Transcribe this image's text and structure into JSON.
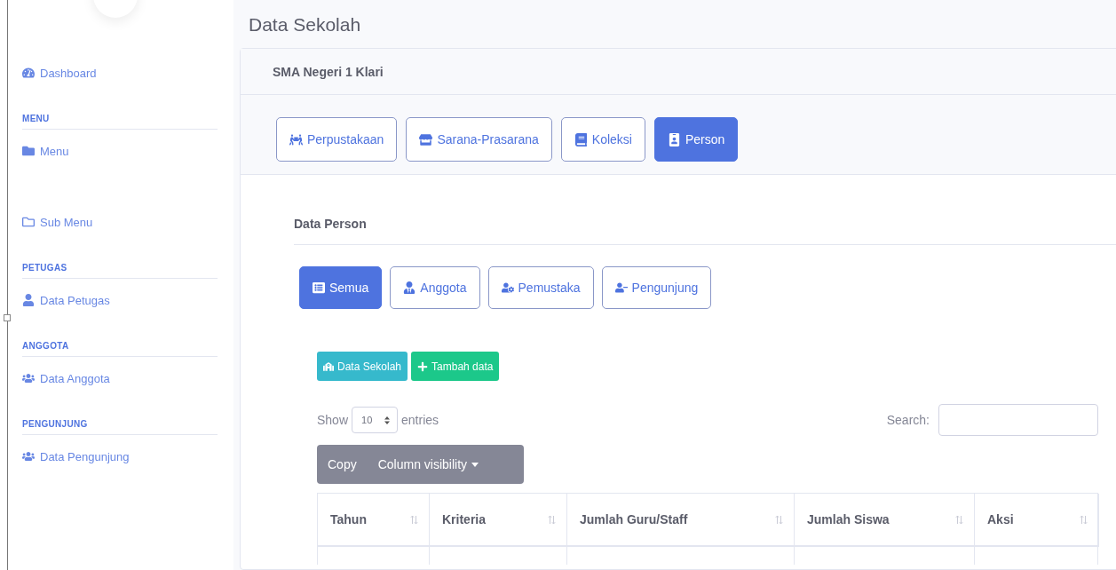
{
  "sidebar": {
    "items": [
      {
        "kind": "link",
        "label": "Dashboard"
      },
      {
        "kind": "heading",
        "label": "MENU"
      },
      {
        "kind": "link",
        "label": "Menu"
      },
      {
        "kind": "link",
        "label": "Sub Menu"
      },
      {
        "kind": "heading",
        "label": "PETUGAS"
      },
      {
        "kind": "link",
        "label": "Data Petugas"
      },
      {
        "kind": "heading",
        "label": "ANGGOTA"
      },
      {
        "kind": "link",
        "label": "Data Anggota"
      },
      {
        "kind": "heading",
        "label": "PENGUNJUNG"
      },
      {
        "kind": "link",
        "label": "Data Pengunjung"
      }
    ]
  },
  "page_title": "Data Sekolah",
  "card": {
    "title": "SMA Negeri 1 Klari",
    "tabs": [
      {
        "label": "Perpustakaan",
        "selected": false
      },
      {
        "label": "Sarana-Prasarana",
        "selected": false
      },
      {
        "label": "Koleksi",
        "selected": false
      },
      {
        "label": "Person",
        "selected": true
      }
    ],
    "section_title": "Data Person",
    "sub_tabs": [
      {
        "label": "Semua",
        "selected": true
      },
      {
        "label": "Anggota",
        "selected": false
      },
      {
        "label": "Pemustaka",
        "selected": false
      },
      {
        "label": "Pengunjung",
        "selected": false
      }
    ],
    "actions": [
      {
        "kind": "info",
        "label": "Data Sekolah"
      },
      {
        "kind": "success",
        "label": "Tambah data"
      }
    ],
    "length": {
      "prefix": "Show",
      "value": "10",
      "suffix": "entries"
    },
    "search": {
      "label": "Search:"
    },
    "export_buttons": [
      {
        "label": "Copy",
        "dropdown": false
      },
      {
        "label": "Column visibility",
        "dropdown": true
      }
    ],
    "table": {
      "columns": [
        "Tahun",
        "Kriteria",
        "Jumlah Guru/Staff",
        "Jumlah Siswa",
        "Aksi"
      ]
    }
  }
}
